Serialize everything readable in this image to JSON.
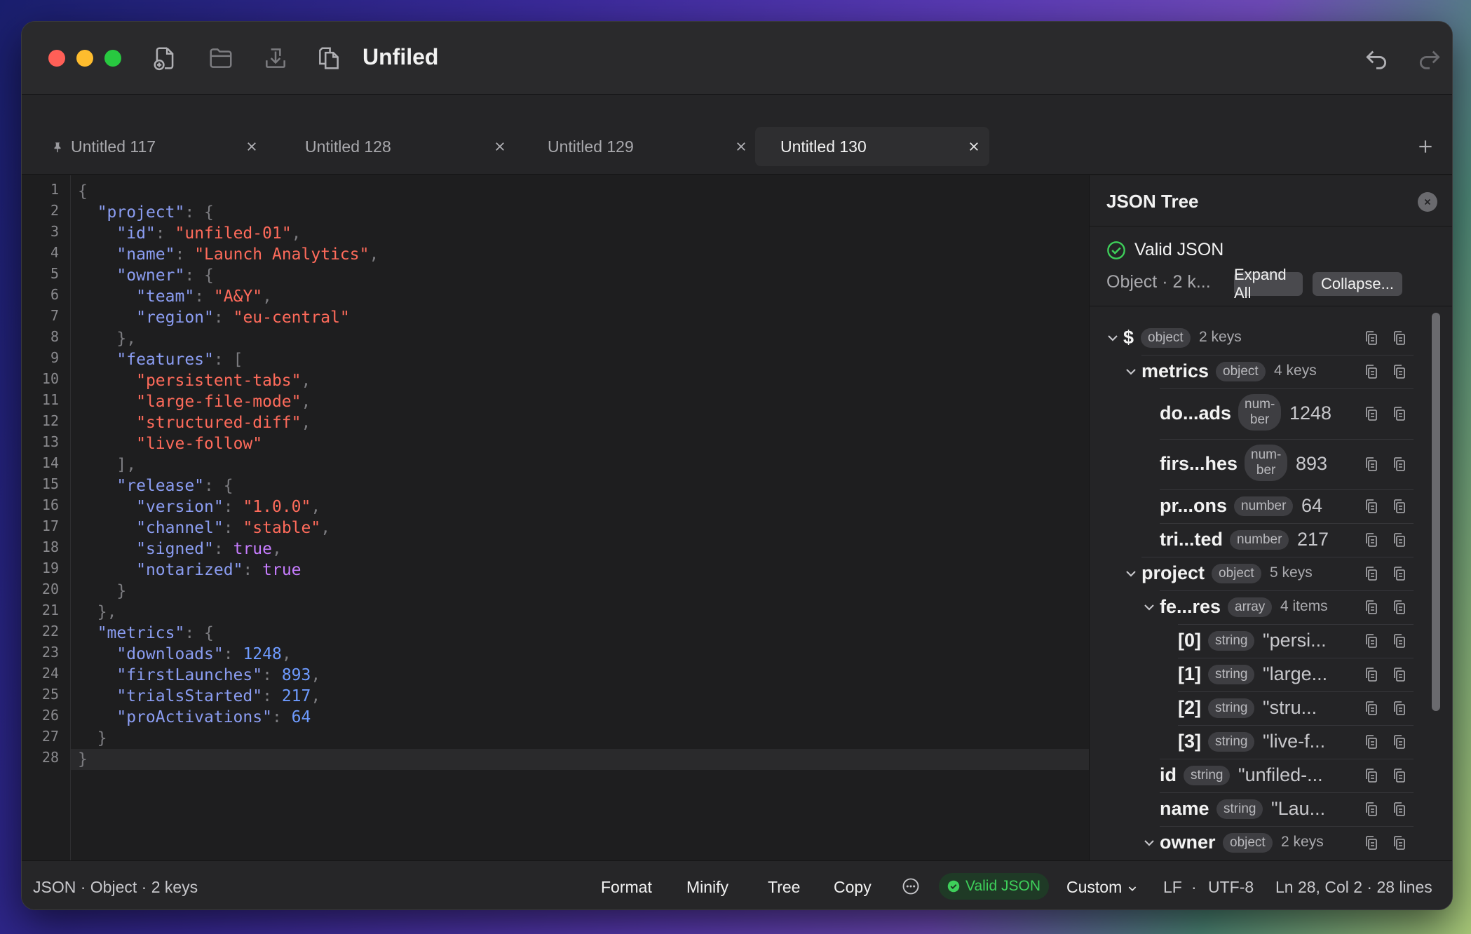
{
  "window": {
    "title": "Unfiled"
  },
  "toolbar": {
    "icons": [
      "new-file-icon",
      "open-folder-icon",
      "save-icon",
      "duplicate-icon",
      "undo-icon",
      "redo-icon"
    ]
  },
  "tabs": [
    {
      "label": "Untitled 117",
      "pinned": true,
      "active": false
    },
    {
      "label": "Untitled 128",
      "pinned": false,
      "active": false
    },
    {
      "label": "Untitled 129",
      "pinned": false,
      "active": false
    },
    {
      "label": "Untitled 130",
      "pinned": false,
      "active": true
    }
  ],
  "editor": {
    "active_line": 28,
    "lines": [
      "{",
      "  \"project\": {",
      "    \"id\": \"unfiled-01\",",
      "    \"name\": \"Launch Analytics\",",
      "    \"owner\": {",
      "      \"team\": \"A&Y\",",
      "      \"region\": \"eu-central\"",
      "    },",
      "    \"features\": [",
      "      \"persistent-tabs\",",
      "      \"large-file-mode\",",
      "      \"structured-diff\",",
      "      \"live-follow\"",
      "    ],",
      "    \"release\": {",
      "      \"version\": \"1.0.0\",",
      "      \"channel\": \"stable\",",
      "      \"signed\": true,",
      "      \"notarized\": true",
      "    }",
      "  },",
      "  \"metrics\": {",
      "    \"downloads\": 1248,",
      "    \"firstLaunches\": 893,",
      "    \"trialsStarted\": 217,",
      "    \"proActivations\": 64",
      "  }",
      "}"
    ]
  },
  "panel": {
    "title": "JSON Tree",
    "valid_text": "Valid JSON",
    "summary": "Object · 2 k...",
    "expand_label": "Expand All",
    "collapse_label": "Collapse...",
    "rows": [
      {
        "key": "$",
        "type": "object",
        "meta": "2 keys",
        "depth": 0,
        "chevron": true
      },
      {
        "key": "metrics",
        "type": "object",
        "meta": "4 keys",
        "depth": 1,
        "chevron": true
      },
      {
        "key": "do...ads",
        "type": "num-\nber",
        "meta": "1248",
        "depth": 2,
        "chevron": false,
        "tall": true
      },
      {
        "key": "firs...hes",
        "type": "num-\nber",
        "meta": "893",
        "depth": 2,
        "chevron": false,
        "tall": true
      },
      {
        "key": "pr...ons",
        "type": "number",
        "meta": "64",
        "depth": 2,
        "chevron": false
      },
      {
        "key": "tri...ted",
        "type": "number",
        "meta": "217",
        "depth": 2,
        "chevron": false
      },
      {
        "key": "project",
        "type": "object",
        "meta": "5 keys",
        "depth": 1,
        "chevron": true
      },
      {
        "key": "fe...res",
        "type": "array",
        "meta": "4 items",
        "depth": 2,
        "chevron": true
      },
      {
        "key": "[0]",
        "type": "string",
        "meta": "\"persi...",
        "depth": 3,
        "chevron": false
      },
      {
        "key": "[1]",
        "type": "string",
        "meta": "\"large...",
        "depth": 3,
        "chevron": false
      },
      {
        "key": "[2]",
        "type": "string",
        "meta": "\"stru...",
        "depth": 3,
        "chevron": false
      },
      {
        "key": "[3]",
        "type": "string",
        "meta": "\"live-f...",
        "depth": 3,
        "chevron": false
      },
      {
        "key": "id",
        "type": "string",
        "meta": "\"unfiled-...",
        "depth": 2,
        "chevron": false
      },
      {
        "key": "name",
        "type": "string",
        "meta": "\"Lau...",
        "depth": 2,
        "chevron": false
      },
      {
        "key": "owner",
        "type": "object",
        "meta": "2 keys",
        "depth": 2,
        "chevron": true
      }
    ]
  },
  "statusbar": {
    "doc_info": "JSON · Object · 2 keys",
    "format": "Format",
    "minify": "Minify",
    "tree": "Tree",
    "copy": "Copy",
    "valid": "Valid JSON",
    "indent": "Custom",
    "line_ending": "LF",
    "dot": "·",
    "encoding": "UTF-8",
    "cursor": "Ln 28, Col 2 · 28 lines"
  },
  "colors": {
    "key": "#8b9df2",
    "string": "#ff6b5b",
    "number": "#6e9bff",
    "boolean": "#c77dff",
    "valid": "#3ecf5a"
  }
}
